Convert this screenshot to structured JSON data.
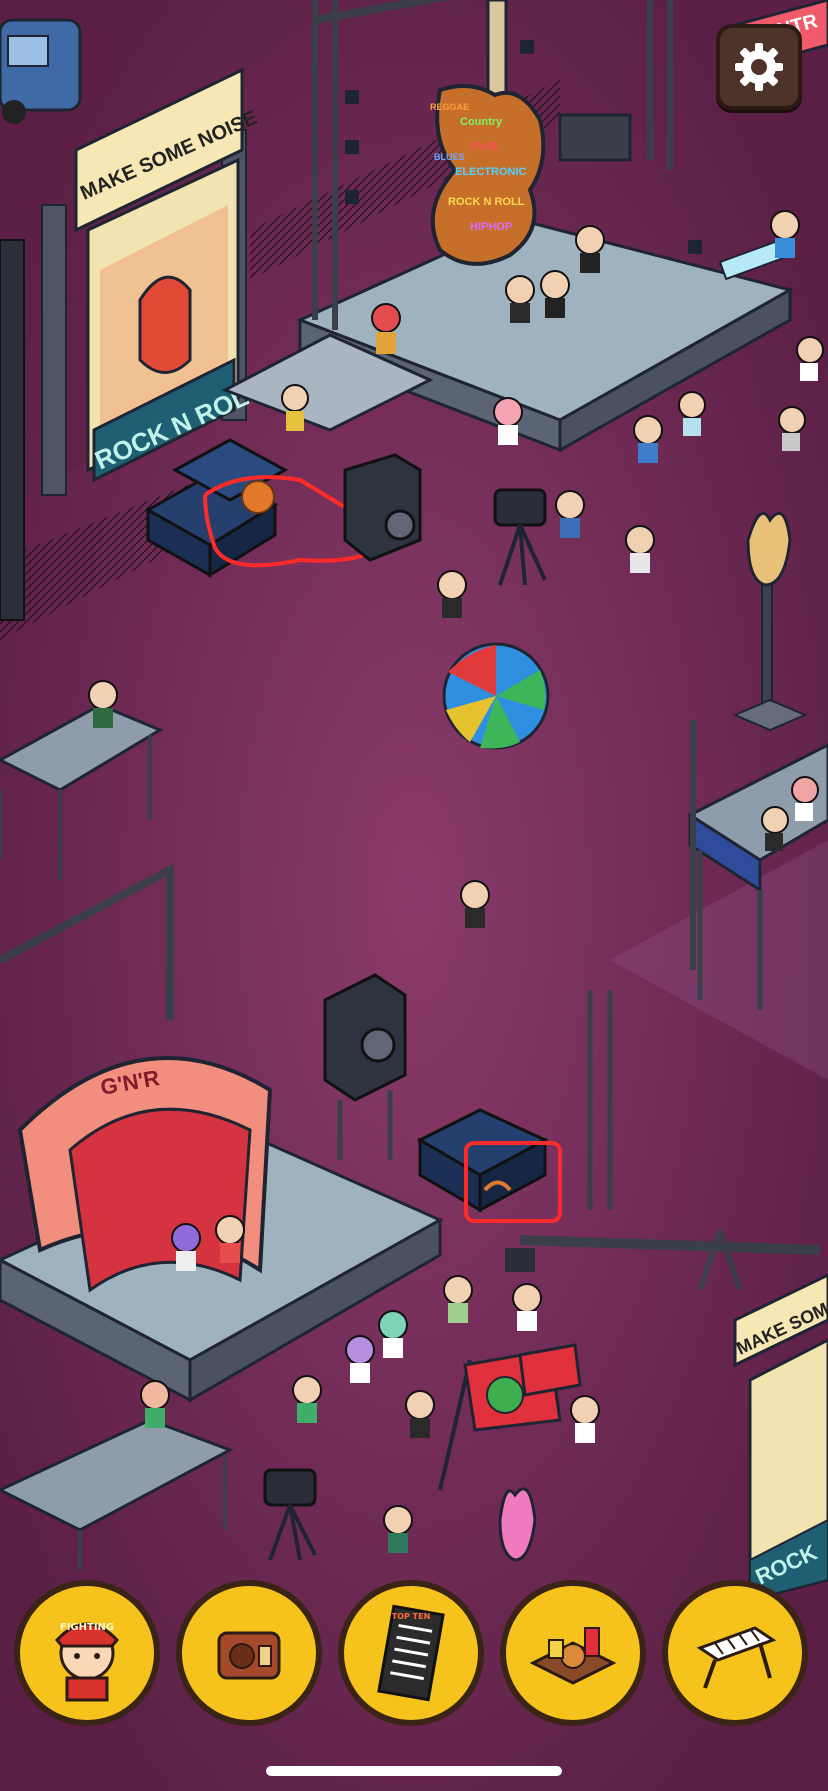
{
  "signs": {
    "banner_top": "MAKE SOME NOISE",
    "poster_bottom": "ROCK N ROLL",
    "top_right_banner": "CONTR",
    "bottom_right_banner": "MAKE SOM",
    "bottom_right_poster": "ROCK"
  },
  "guitar_genres": [
    "Country",
    "R'n'B",
    "ELECTRONIC",
    "ROCK N ROLL",
    "HIPHOP",
    "BLUES",
    "REGGAE"
  ],
  "stage_arch_label": "G'N'R",
  "item_bar": {
    "items": [
      {
        "name": "fighting-mascot",
        "label": "FIGHTING"
      },
      {
        "name": "radio",
        "label": ""
      },
      {
        "name": "setlist-board",
        "label": "TOP TEN"
      },
      {
        "name": "fast-food-tray",
        "label": ""
      },
      {
        "name": "keyboard-stand",
        "label": ""
      }
    ]
  },
  "colors": {
    "ground": "#6e2a55",
    "highlight_circle": "#ff2a2a",
    "item_slot": "#f6c21c",
    "settings_bg": "#4e3328"
  },
  "icons": {
    "settings": "gear-icon"
  }
}
